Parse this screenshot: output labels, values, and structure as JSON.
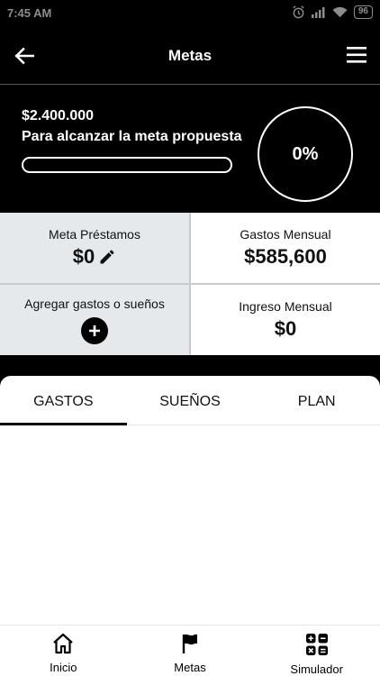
{
  "status_bar": {
    "time": "7:45 AM",
    "battery": "96"
  },
  "app_bar": {
    "title": "Metas"
  },
  "summary": {
    "goal_amount": "$2.400.000",
    "goal_text": "Para alcanzar la meta propuesta",
    "progress_fraction": 0,
    "progress_percent": "0%"
  },
  "cards": {
    "loan_goal": {
      "label": "Meta Préstamos",
      "value": "$0"
    },
    "monthly_expenses": {
      "label": "Gastos Mensual",
      "value": "$585,600"
    },
    "add_expense": {
      "label": "Agregar gastos o sueños"
    },
    "monthly_income": {
      "label": "Ingreso Mensual",
      "value": "$0"
    }
  },
  "tabs": [
    {
      "label": "GASTOS",
      "active": true
    },
    {
      "label": "SUEÑOS",
      "active": false
    },
    {
      "label": "PLAN",
      "active": false
    }
  ],
  "bottom_nav": [
    {
      "label": "Inicio",
      "icon": "home-icon"
    },
    {
      "label": "Metas",
      "icon": "flag-icon"
    },
    {
      "label": "Simulador",
      "icon": "calculator-icon"
    }
  ],
  "colors": {
    "header_bg": "#000000",
    "card_gray": "#e6e9eb",
    "accent": "#000000"
  }
}
